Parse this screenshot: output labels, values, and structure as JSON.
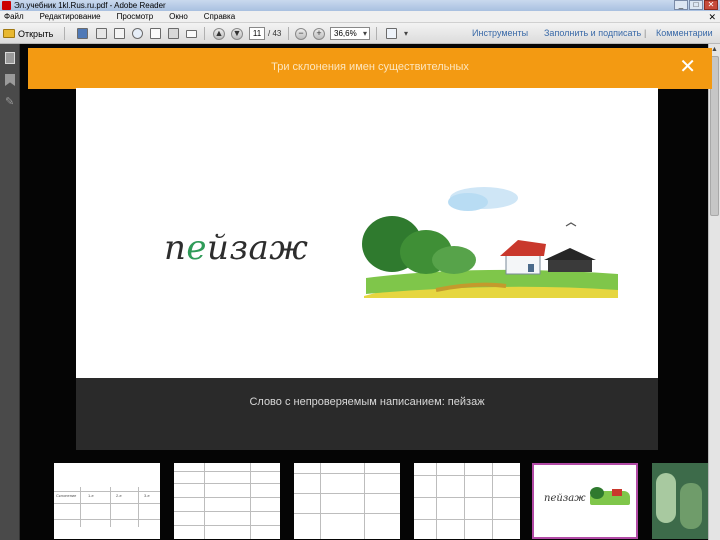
{
  "window": {
    "title": "Эл.учебник 1kl.Rus.ru.pdf - Adobe Reader",
    "controls": [
      "_",
      "□",
      "✕"
    ]
  },
  "menubar": {
    "items": [
      "Файл",
      "Редактирование",
      "Просмотр",
      "Окно",
      "Справка"
    ],
    "close_glyph": "✕"
  },
  "toolbar": {
    "open_label": "Открыть",
    "current_page": "11",
    "total_pages": "/ 43",
    "zoom": "36,6%",
    "tools_label": "Инструменты",
    "sign_label": "Заполнить и подписать",
    "comments_label": "Комментарии",
    "icons": [
      "save-icon",
      "print-icon",
      "email-icon",
      "cloud-icon",
      "page-up-icon",
      "page-down-icon",
      "zoom-out-icon",
      "zoom-in-icon",
      "annotate-icon"
    ]
  },
  "sidebar": {
    "icons": [
      "pages-icon",
      "bookmark-icon",
      "attachment-icon"
    ]
  },
  "slideshow": {
    "header_title": "Три склонения имен существительных",
    "close_glyph": "✕",
    "word": "пейзаж",
    "caption": "Слово с непроверяемым написанием: пейзаж",
    "accent_color": "#f39a12",
    "selected_thumb_color": "#b24aa6",
    "thumbnails": [
      "thumb-table-1",
      "thumb-table-2",
      "thumb-table-3",
      "thumb-table-4",
      "thumb-peizazh",
      "thumb-photo"
    ],
    "selected_index": 4
  },
  "thumb_texts": {
    "t1": [
      "Склонение",
      "1-е",
      "2-е",
      "3-е"
    ],
    "t5": "пейзаж"
  }
}
